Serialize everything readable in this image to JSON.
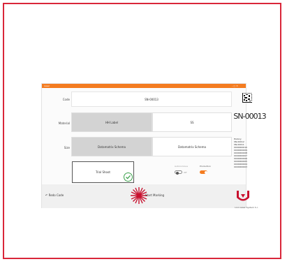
{
  "window": {
    "title": "Laser",
    "controls": "– □ ✕"
  },
  "form": {
    "code_label": "Code",
    "code_value": "SN-00013",
    "material_label": "Material",
    "material_options": [
      "HH Label",
      "SS"
    ],
    "material_selected": "HH Label",
    "size_label": "Size",
    "size_options": [
      "Datamatrix Schema",
      "Datamatrix Schema"
    ],
    "trial_label": "Trial Shoot",
    "toggle1_label": "Autonomous",
    "toggle1_state": "Off",
    "toggle2_label": "Production",
    "redo_label": "↶ Redo Code",
    "start_label": "Start Marking"
  },
  "side": {
    "serial": "SN-00013",
    "history_title": "History",
    "history_items": [
      "SN-00012",
      "SN-00011",
      "0000000010",
      "0000000009",
      "0000000008",
      "0000000007",
      "0000000006",
      "0000000005",
      "0000000004",
      "0000000003"
    ],
    "company": "Lion Laser System S.r."
  },
  "colors": {
    "accent": "#f47c20",
    "success": "#3aa04a",
    "laser": "#c8102e",
    "frame": "#d9263a"
  }
}
